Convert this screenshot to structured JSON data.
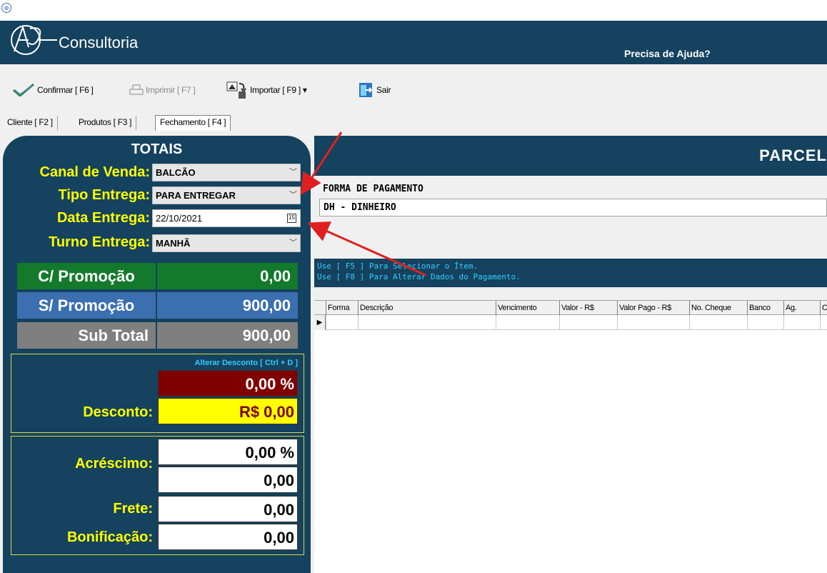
{
  "header": {
    "logo_text": "Consultoria",
    "help_label": "Precisa de Ajuda?"
  },
  "toolbar": {
    "confirm_label": "Confirmar [ F6 ]",
    "print_label": "Imprimir [ F7 ]",
    "import_label": "Importar [ F9 ] ▾",
    "exit_label": "Sair"
  },
  "tabs": [
    {
      "label": "Cliente [ F2 ]"
    },
    {
      "label": "Produtos [ F3 ]"
    },
    {
      "label": "Fechamento [ F4 ]",
      "active": true
    }
  ],
  "totais": {
    "title": "TOTAIS",
    "canal_venda": {
      "label": "Canal de Venda:",
      "value": "BALCÃO"
    },
    "tipo_entrega": {
      "label": "Tipo Entrega:",
      "value": "PARA ENTREGAR"
    },
    "data_entrega": {
      "label": "Data Entrega:",
      "value": "22/10/2021"
    },
    "turno_entrega": {
      "label": "Turno Entrega:",
      "value": "MANHÃ"
    },
    "com_promocao": {
      "label": "C/ Promoção",
      "value": "0,00"
    },
    "sem_promocao": {
      "label": "S/ Promoção",
      "value": "900,00"
    },
    "sub_total": {
      "label": "Sub Total",
      "value": "900,00"
    },
    "desconto": {
      "alter_hint": "Alterar Desconto  [ Ctrl + D ]",
      "percent": "0,00 %",
      "label": "Desconto:",
      "value": "R$ 0,00"
    },
    "acrescimo": {
      "label": "Acréscimo:",
      "percent": "0,00 %",
      "value": "0,00"
    },
    "frete": {
      "label": "Frete:",
      "value": "0,00"
    },
    "bonificacao": {
      "label": "Bonificação:",
      "value": "0,00"
    }
  },
  "parcelas": {
    "title": "PARCEL",
    "forma_pagamento_label": "FORMA DE PAGAMENTO",
    "forma_pagamento_value": "DH - DINHEIRO",
    "hints": [
      "Use [ F5 ] Para Selecionar o Ítem.",
      "Use [ F8 ] Para Alterar Dados do Pagamento."
    ],
    "columns": [
      "Forma",
      "Descrição",
      "Vencimento",
      "Valor - R$",
      "Valor Pago - R$",
      "No. Cheque",
      "Banco",
      "Ag.",
      "C"
    ]
  },
  "colors": {
    "navy": "#15425e",
    "yellow": "#ffff00",
    "promo_green": "#137a2b",
    "promo_blue": "#3c6fb0",
    "subtotal_gray": "#7f7f7f",
    "discount_red": "#800000",
    "annotation_red": "#e02020"
  }
}
